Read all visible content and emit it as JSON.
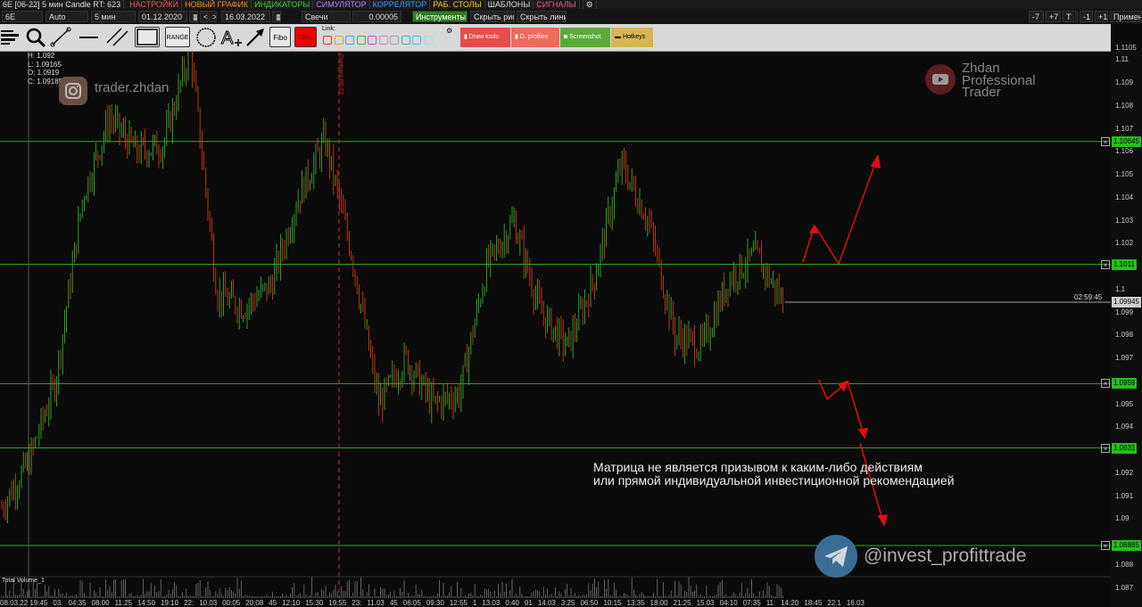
{
  "topbar": {
    "title": "6E [06-22] 5 мин Candle RT: 623",
    "menu": [
      {
        "label": "НАСТРОЙКИ",
        "color": "#ff5050"
      },
      {
        "label": "НОВЫЙ ГРАФИК",
        "color": "#ff8c1a"
      },
      {
        "label": "ИНДИКАТОРЫ",
        "color": "#35d24a"
      },
      {
        "label": "СИМУЛЯТОР",
        "color": "#c07cff"
      },
      {
        "label": "КОРРЕЛЯТОР",
        "color": "#3aa0ff"
      },
      {
        "label": "РАБ. СТОЛЫ",
        "color": "#ffd21a"
      },
      {
        "label": "ШАБЛОНЫ",
        "color": "#dddddd"
      },
      {
        "label": "СИГНАЛЫ",
        "color": "#ff4fa0"
      }
    ],
    "settings_icon": "gear-icon"
  },
  "bar2": {
    "symbol": "6E",
    "mode": "Auto",
    "timeframe": "5 мин",
    "date_from": "01.12.2020",
    "nav_prev": "<",
    "nav_next": ">",
    "date_to": "16.03.2022",
    "chart_type": "Свечи",
    "tick": "0.00005",
    "instruments": "Инструменты",
    "hide_drawings": "Скрыть рис.",
    "hide_lines": "Скрыть линии",
    "minus7": "-7",
    "plus7": "+7",
    "t": "T",
    "minus1": "-1",
    "plus1": "+1",
    "apply": "Применить"
  },
  "toolbar": {
    "range_label": "RANGE",
    "fibo_label": "Fibo",
    "color_label": "Color",
    "link_label": "Link:",
    "link_colors": [
      "#e03030",
      "#f0a020",
      "#40a0ff",
      "#30c040",
      "#e040e0",
      "#e080c0",
      "#a0a0a0",
      "#30c0c0",
      "#40c0ff",
      "#a0e0e0"
    ],
    "draw_tools": "Draw tools",
    "d_profiles": "D. profiles",
    "screenshot": "Screenshot",
    "hotkeys": "Hotkeys"
  },
  "ohlc": {
    "h": "H: 1.092",
    "l": "L: 1.09165",
    "o": "O: 1.0919",
    "c": "C: 1.09185"
  },
  "watermarks": {
    "instagram": "trader.zhdan",
    "youtube_l1": "Zhdan",
    "youtube_l2": "Professional",
    "youtube_l3": "Trader",
    "telegram": "@invest_profittrade"
  },
  "disclaimer": {
    "line1": "Матрица не является призывом к каким-либо действиям",
    "line2": "или прямой индивидуальной инвестиционной рекомендацией"
  },
  "contract_label": "Contract 06-22",
  "timer": "02:59:45",
  "volume_label": "Total Volume_1",
  "price_axis": [
    "1.1105",
    "1.11",
    "1.109",
    "1.108",
    "1.107",
    "1.106",
    "1.105",
    "1.104",
    "1.103",
    "1.102",
    "1.1",
    "1.099",
    "1.098",
    "1.097",
    "1.095",
    "1.094",
    "1.092",
    "1.091",
    "1.09",
    "1.088",
    "1.087"
  ],
  "levels": [
    {
      "label": "1.10645",
      "price": 1.10645
    },
    {
      "label": "1.1011",
      "price": 1.1011
    },
    {
      "label": "1.0959",
      "price": 1.0959
    },
    {
      "label": "1.0931",
      "price": 1.0931
    },
    {
      "label": "1.08885",
      "price": 1.08885
    }
  ],
  "current_price": "1.09945",
  "time_axis": [
    "08.03.22 19:45",
    "03.",
    "04:35",
    "08:00",
    "11:25",
    "14:50",
    "19:10",
    "22:",
    "10.03",
    "00:05",
    "20:08",
    "45",
    "12:10",
    "15:30",
    "19:55",
    "23:",
    "11.03",
    "45",
    "06:05",
    "09:30",
    "12:55",
    "1",
    "13.03",
    "0:40",
    "01",
    "14.03",
    "3:25",
    "06:50",
    "10:15",
    "13:35",
    "18:00",
    "21:25",
    "15.03",
    "04:10",
    "07:35",
    "11:",
    "14:20",
    "18:45",
    "22:1",
    "16.03"
  ],
  "chart_data": {
    "type": "candlestick",
    "symbol": "6E [06-22]",
    "timeframe": "5 мин",
    "ylim": [
      1.0865,
      1.1108
    ],
    "approx_close_path": [
      {
        "t": "08.03 19:45",
        "p": 1.0905
      },
      {
        "t": "09.03 04:35",
        "p": 1.0925
      },
      {
        "t": "09.03 08:00",
        "p": 1.096
      },
      {
        "t": "09.03 11:25",
        "p": 1.104
      },
      {
        "t": "09.03 14:50",
        "p": 1.1075
      },
      {
        "t": "09.03 19:10",
        "p": 1.106
      },
      {
        "t": "10.03 00:05",
        "p": 1.1063
      },
      {
        "t": "10.03 08:45",
        "p": 1.1105
      },
      {
        "t": "10.03 12:10",
        "p": 1.0998
      },
      {
        "t": "10.03 15:30",
        "p": 1.0992
      },
      {
        "t": "10.03 19:55",
        "p": 1.1002
      },
      {
        "t": "11.03 00:45",
        "p": 1.104
      },
      {
        "t": "11.03 06:05",
        "p": 1.1065
      },
      {
        "t": "11.03 09:30",
        "p": 1.1015
      },
      {
        "t": "11.03 12:55",
        "p": 1.095
      },
      {
        "t": "13.03 00:40",
        "p": 1.097
      },
      {
        "t": "14.03 01:00",
        "p": 1.095
      },
      {
        "t": "14.03 03:25",
        "p": 1.0955
      },
      {
        "t": "14.03 06:50",
        "p": 1.101
      },
      {
        "t": "14.03 10:15",
        "p": 1.103
      },
      {
        "t": "14.03 13:35",
        "p": 1.099
      },
      {
        "t": "14.03 18:00",
        "p": 1.0975
      },
      {
        "t": "14.03 21:25",
        "p": 1.1005
      },
      {
        "t": "15.03 04:10",
        "p": 1.1055
      },
      {
        "t": "15.03 07:35",
        "p": 1.103
      },
      {
        "t": "15.03 11:00",
        "p": 1.098
      },
      {
        "t": "15.03 14:20",
        "p": 1.0975
      },
      {
        "t": "15.03 18:45",
        "p": 1.1005
      },
      {
        "t": "15.03 22:10",
        "p": 1.1015
      },
      {
        "t": "16.03 00:00",
        "p": 1.09945
      }
    ]
  }
}
